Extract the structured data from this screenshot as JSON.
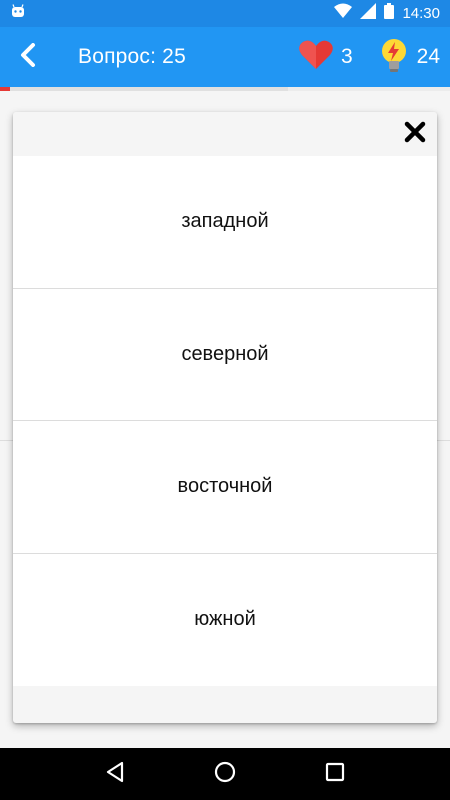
{
  "status_bar": {
    "time": "14:30",
    "icons": [
      "android-icon",
      "wifi-icon",
      "signal-icon",
      "battery-icon"
    ]
  },
  "app_bar": {
    "title": "Вопрос: 25",
    "lives": "3",
    "hints": "24",
    "color": "#2196f3"
  },
  "progress": {
    "fraction": 0.64,
    "accent_color": "#e53935"
  },
  "dialog": {
    "answers": [
      {
        "label": "западной"
      },
      {
        "label": "северной"
      },
      {
        "label": "восточной"
      },
      {
        "label": "южной"
      }
    ]
  },
  "nav_bar": {
    "buttons": [
      "back-triangle-icon",
      "home-circle-icon",
      "recents-square-icon"
    ]
  }
}
